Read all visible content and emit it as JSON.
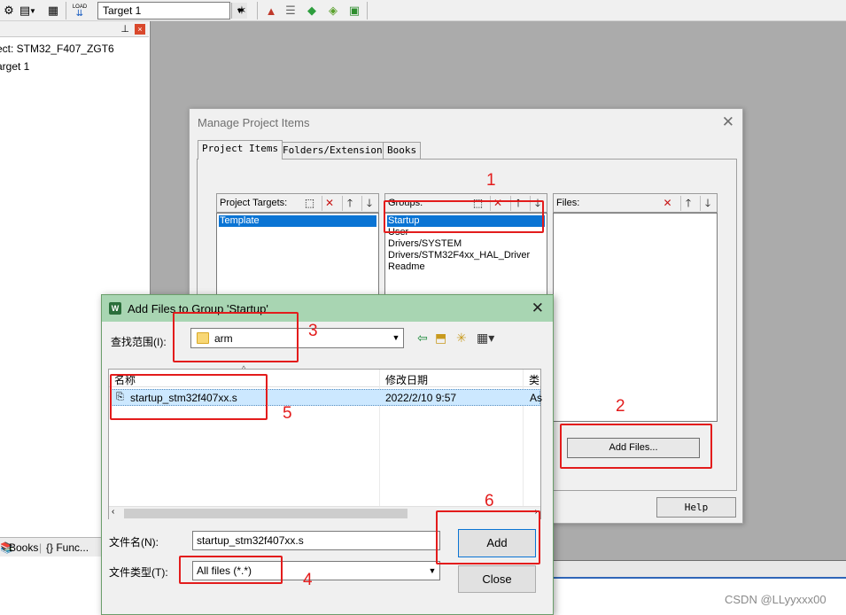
{
  "toolbar": {
    "target": "Target 1",
    "load_label": "LOAD"
  },
  "project_pane": {
    "line1": "ect: STM32_F407_ZGT6",
    "line2": "arget 1",
    "tabs": [
      "Books",
      "{} Func..."
    ]
  },
  "manage_dialog": {
    "title": "Manage Project Items",
    "tabs": [
      "Project Items",
      "Folders/Extensions",
      "Books"
    ],
    "targets": {
      "caption": "Project Targets:",
      "items": [
        "Template"
      ]
    },
    "groups": {
      "caption": "Groups:",
      "items": [
        "Startup",
        "User",
        "Drivers/SYSTEM",
        "Drivers/STM32F4xx_HAL_Driver",
        "Readme"
      ]
    },
    "files": {
      "caption": "Files:"
    },
    "add_files_button": "Add Files...",
    "help_button": "Help"
  },
  "add_dialog": {
    "title": "Add Files to Group 'Startup'",
    "look_in_label": "查找范围(I):",
    "look_in_value": "arm",
    "columns": [
      "名称",
      "修改日期",
      "类"
    ],
    "file": {
      "name": "startup_stm32f407xx.s",
      "date": "2022/2/10 9:57",
      "type": "As"
    },
    "filename_label": "文件名(N):",
    "filename_value": "startup_stm32f407xx.s",
    "filetype_label": "文件类型(T):",
    "filetype_value": "All files (*.*)",
    "add_button": "Add",
    "close_button": "Close"
  },
  "annotations": [
    "1",
    "2",
    "3",
    "4",
    "5",
    "6"
  ],
  "watermark": "CSDN @LLyyxxx00",
  "colors": {
    "annotation": "#e31c1c",
    "selection": "#0a74d4",
    "dialog_title": "#a8d5b2"
  }
}
